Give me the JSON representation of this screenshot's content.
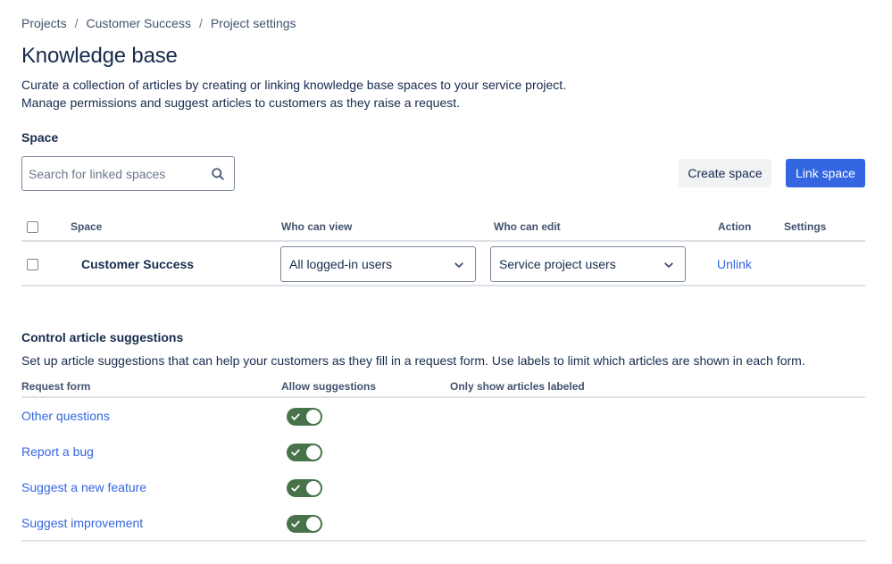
{
  "breadcrumb": {
    "items": [
      "Projects",
      "Customer Success",
      "Project settings"
    ],
    "separator": "/"
  },
  "page": {
    "title": "Knowledge base",
    "description_line1": "Curate a collection of articles by creating or linking knowledge base spaces to your service project.",
    "description_line2": "Manage permissions and suggest articles to customers as they raise a request."
  },
  "space_section": {
    "label": "Space",
    "search_placeholder": "Search for linked spaces",
    "search_icon": "search-icon",
    "create_button": "Create space",
    "link_button": "Link space"
  },
  "table": {
    "headers": {
      "space": "Space",
      "who_can_view": "Who can view",
      "who_can_edit": "Who can edit",
      "action": "Action",
      "settings": "Settings"
    },
    "rows": [
      {
        "space": "Customer Success",
        "who_can_view": "All logged-in users",
        "who_can_edit": "Service project users",
        "action": "Unlink"
      }
    ]
  },
  "suggestions": {
    "title": "Control article suggestions",
    "description": "Set up article suggestions that can help your customers as they fill in a request form. Use labels to limit which articles are shown in each form.",
    "headers": {
      "request_form": "Request form",
      "allow_suggestions": "Allow suggestions",
      "only_show": "Only show articles labeled"
    },
    "forms": [
      {
        "name": "Other questions",
        "allow": true
      },
      {
        "name": "Report a bug",
        "allow": true
      },
      {
        "name": "Suggest a new feature",
        "allow": true
      },
      {
        "name": "Suggest improvement",
        "allow": true
      }
    ]
  },
  "colors": {
    "primary": "#3366e0",
    "toggle_on": "#487349",
    "text": "#172b4d",
    "border": "#dfe1e6"
  }
}
